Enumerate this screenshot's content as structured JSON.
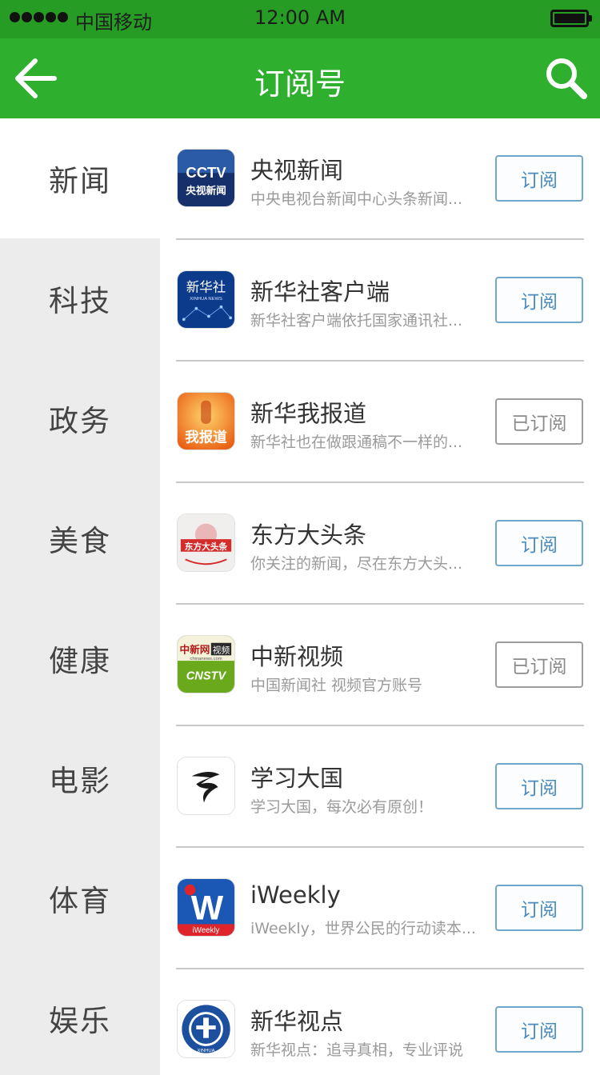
{
  "status_bar": {
    "carrier": "中国移动",
    "time": "12:00 AM"
  },
  "nav": {
    "title": "订阅号",
    "back_icon": "arrow-left-icon",
    "search_icon": "search-icon",
    "color": "#2eaf2e"
  },
  "sidebar": {
    "items": [
      {
        "label": "新闻",
        "active": true
      },
      {
        "label": "科技",
        "active": false
      },
      {
        "label": "政务",
        "active": false
      },
      {
        "label": "美食",
        "active": false
      },
      {
        "label": "健康",
        "active": false
      },
      {
        "label": "电影",
        "active": false
      },
      {
        "label": "体育",
        "active": false
      },
      {
        "label": "娱乐",
        "active": false
      }
    ]
  },
  "accounts": [
    {
      "name": "央视新闻",
      "desc": "中央电视台新闻中心头条新闻...",
      "button": "订阅",
      "subscribed": false,
      "logo": "cctv-news-logo"
    },
    {
      "name": "新华社客户端",
      "desc": "新华社客户端依托国家通讯社...",
      "button": "订阅",
      "subscribed": false,
      "logo": "xinhua-news-logo"
    },
    {
      "name": "新华我报道",
      "desc": "新华社也在做跟通稿不一样的...",
      "button": "已订阅",
      "subscribed": true,
      "logo": "xinhua-wo-baodao-logo"
    },
    {
      "name": "东方大头条",
      "desc": "你关注的新闻，尽在东方大头...",
      "button": "订阅",
      "subscribed": false,
      "logo": "dongfang-toutiao-logo"
    },
    {
      "name": "中新视频",
      "desc": "中国新闻社 视频官方账号",
      "button": "已订阅",
      "subscribed": true,
      "logo": "cnstv-logo"
    },
    {
      "name": "学习大国",
      "desc": "学习大国，每次必有原创！",
      "button": "订阅",
      "subscribed": false,
      "logo": "xuexi-daguo-logo"
    },
    {
      "name": "iWeekly",
      "desc": "iWeekly，世界公民的行动读本...",
      "button": "订阅",
      "subscribed": false,
      "logo": "iweekly-logo"
    },
    {
      "name": "新华视点",
      "desc": "新华视点：追寻真相，专业评说",
      "button": "订阅",
      "subscribed": false,
      "logo": "xinhua-shidian-logo"
    }
  ],
  "logo_text": {
    "cctv_top": "CCTV",
    "cctv_bottom": "央视新闻",
    "xinhua_top": "新华社",
    "xinhua_sub": "XINHUA NEWS",
    "wobaodao": "我报道",
    "dongfang": "东方大头条",
    "cnstv_top": "中新网",
    "cnstv_tag": "视频",
    "cnstv_url": "chinanews.com",
    "cnstv_bottom": "CNSTV",
    "iweekly_mark": "W",
    "iweekly_label": "iWeekly",
    "shidian_ring": "XINHUA"
  }
}
